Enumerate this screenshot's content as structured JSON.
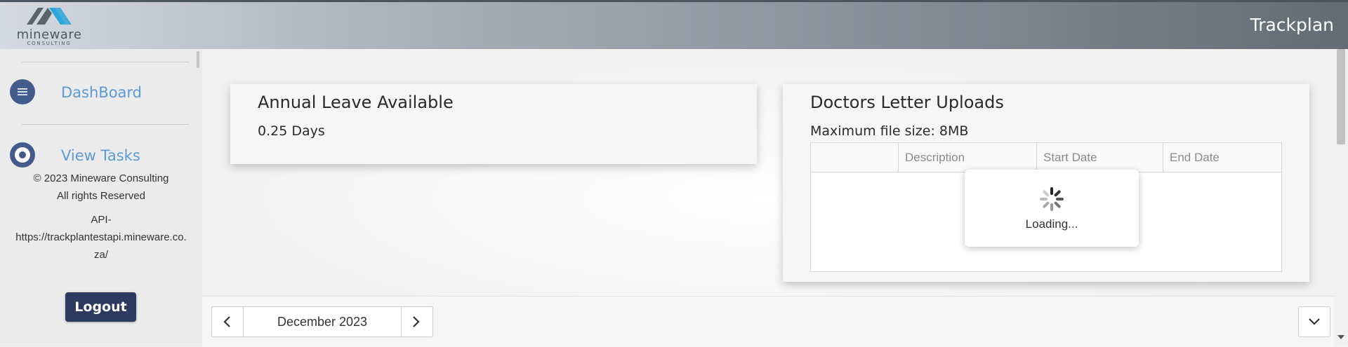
{
  "header": {
    "logo_word": "mineware",
    "logo_sub": "CONSULTING",
    "app_title": "Trackplan"
  },
  "sidebar": {
    "items": [
      {
        "label": "DashBoard",
        "icon": "menu-icon"
      },
      {
        "label": "View Tasks",
        "icon": "target-icon"
      }
    ],
    "copyright": "© 2023 Mineware Consulting",
    "rights": "All rights Reserved",
    "api_line1": "API-",
    "api_line2": "https://trackplantestapi.mineware.co.",
    "api_line3": "za/",
    "logout_label": "Logout"
  },
  "leave_card": {
    "title": "Annual Leave Available",
    "value": "0.25 Days"
  },
  "uploads_card": {
    "title": "Doctors Letter Uploads",
    "max_size": "Maximum file size: 8MB",
    "columns": [
      "",
      "Description",
      "Start Date",
      "End Date"
    ],
    "loading_text": "Loading..."
  },
  "footer": {
    "month_label": "December 2023",
    "prev_icon": "chevron-left-icon",
    "next_icon": "chevron-right-icon",
    "expand_icon": "chevron-down-icon"
  },
  "colors": {
    "brand_dark": "#2b3a5e",
    "nav_icon": "#435b8a",
    "link": "#5b9ad5",
    "logo_accent": "#2ca6d9"
  }
}
